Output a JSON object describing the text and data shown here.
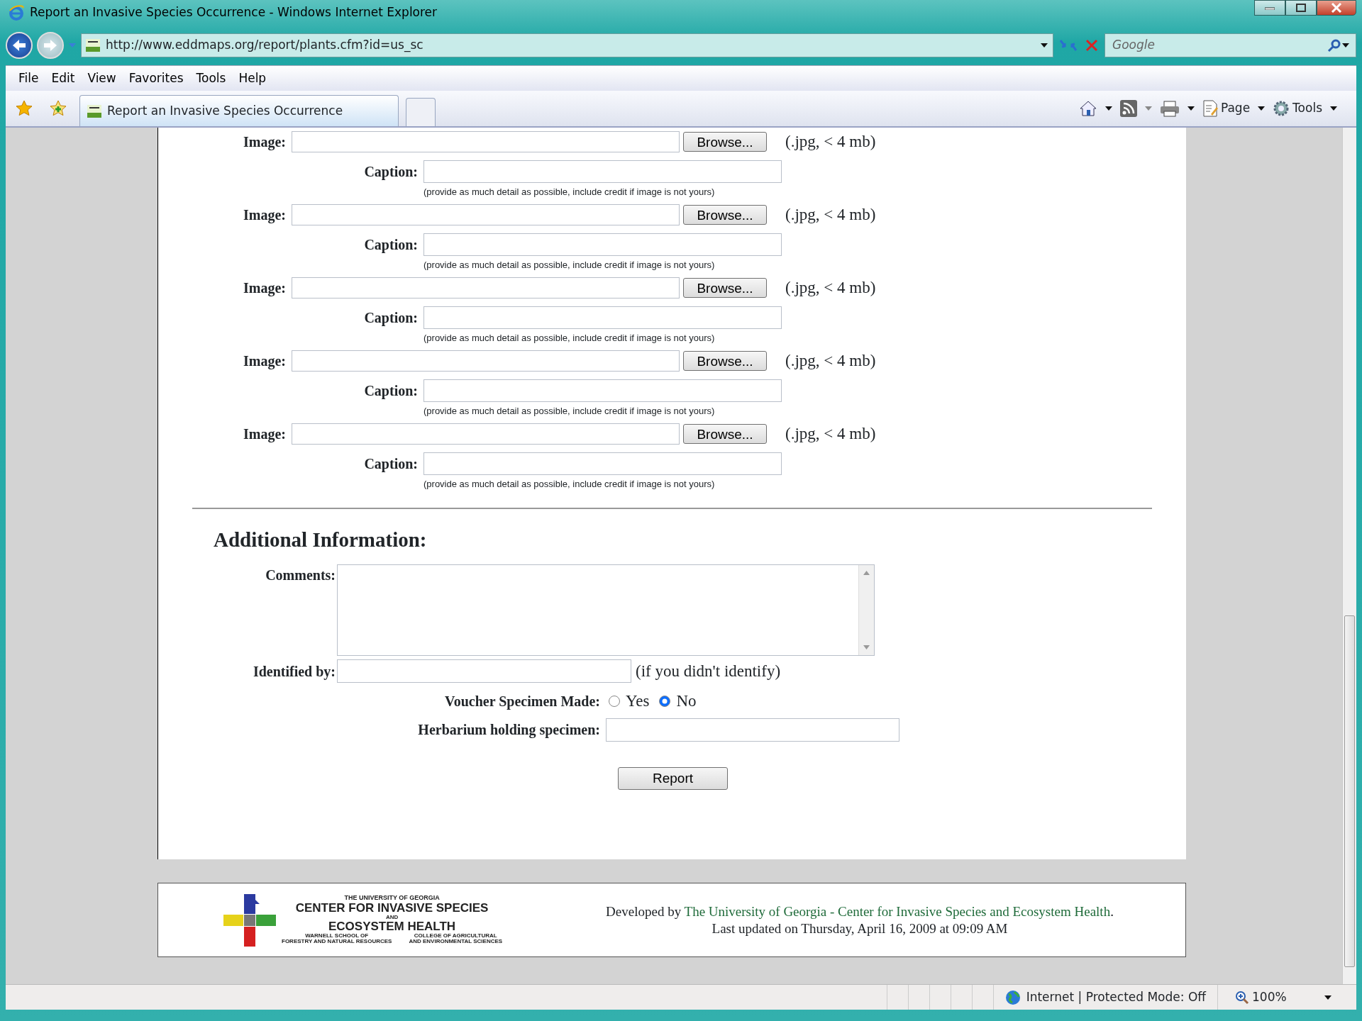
{
  "window": {
    "title": "Report an Invasive Species Occurrence - Windows Internet Explorer"
  },
  "address_bar": {
    "url": "http://www.eddmaps.org/report/plants.cfm?id=us_sc"
  },
  "search": {
    "placeholder": "Google"
  },
  "menu": [
    "File",
    "Edit",
    "View",
    "Favorites",
    "Tools",
    "Help"
  ],
  "tabs": [
    {
      "label": "Report an Invasive Species Occurrence",
      "selected": true
    }
  ],
  "command_bar": [
    "Page",
    "Tools"
  ],
  "image_uploads": [
    {
      "label": "Image:",
      "button": "Browse...",
      "note": "(.jpg, < 4 mb)",
      "caption_label": "Caption:",
      "caption_hint": "(provide as much detail as possible, include credit if image is not yours)"
    },
    {
      "label": "Image:",
      "button": "Browse...",
      "note": "(.jpg, < 4 mb)",
      "caption_label": "Caption:",
      "caption_hint": "(provide as much detail as possible, include credit if image is not yours)"
    },
    {
      "label": "Image:",
      "button": "Browse...",
      "note": "(.jpg, < 4 mb)",
      "caption_label": "Caption:",
      "caption_hint": "(provide as much detail as possible, include credit if image is not yours)"
    },
    {
      "label": "Image:",
      "button": "Browse...",
      "note": "(.jpg, < 4 mb)",
      "caption_label": "Caption:",
      "caption_hint": "(provide as much detail as possible, include credit if image is not yours)"
    },
    {
      "label": "Image:",
      "button": "Browse...",
      "note": "(.jpg, < 4 mb)",
      "caption_label": "Caption:",
      "caption_hint": "(provide as much detail as possible, include credit if image is not yours)"
    }
  ],
  "additional": {
    "heading": "Additional Information:",
    "comments_label": "Comments:",
    "identified_label": "Identified by:",
    "identified_note": "(if you didn't identify)",
    "voucher_label": "Voucher Specimen Made:",
    "voucher_options": [
      {
        "label": "Yes",
        "selected": false
      },
      {
        "label": "No",
        "selected": true
      }
    ],
    "herbarium_label": "Herbarium holding specimen:",
    "submit": "Report"
  },
  "footer": {
    "logo_lines": [
      "THE UNIVERSITY OF GEORGIA",
      "CENTER FOR INVASIVE SPECIES",
      "AND",
      "ECOSYSTEM HEALTH"
    ],
    "logo_small": [
      [
        "WARNELL SCHOOL OF",
        "FORESTRY AND NATURAL RESOURCES"
      ],
      [
        "COLLEGE OF AGRICULTURAL",
        "AND ENVIRONMENTAL SCIENCES"
      ]
    ],
    "credit_prefix": "Developed by ",
    "credit_link": "The University of Georgia - Center for Invasive Species and Ecosystem Health",
    "credit_suffix": ".",
    "updated": "Last updated on Thursday, April 16, 2009 at 09:09 AM"
  },
  "status_bar": {
    "zone": "Internet | Protected Mode: Off",
    "zoom": "100%"
  }
}
